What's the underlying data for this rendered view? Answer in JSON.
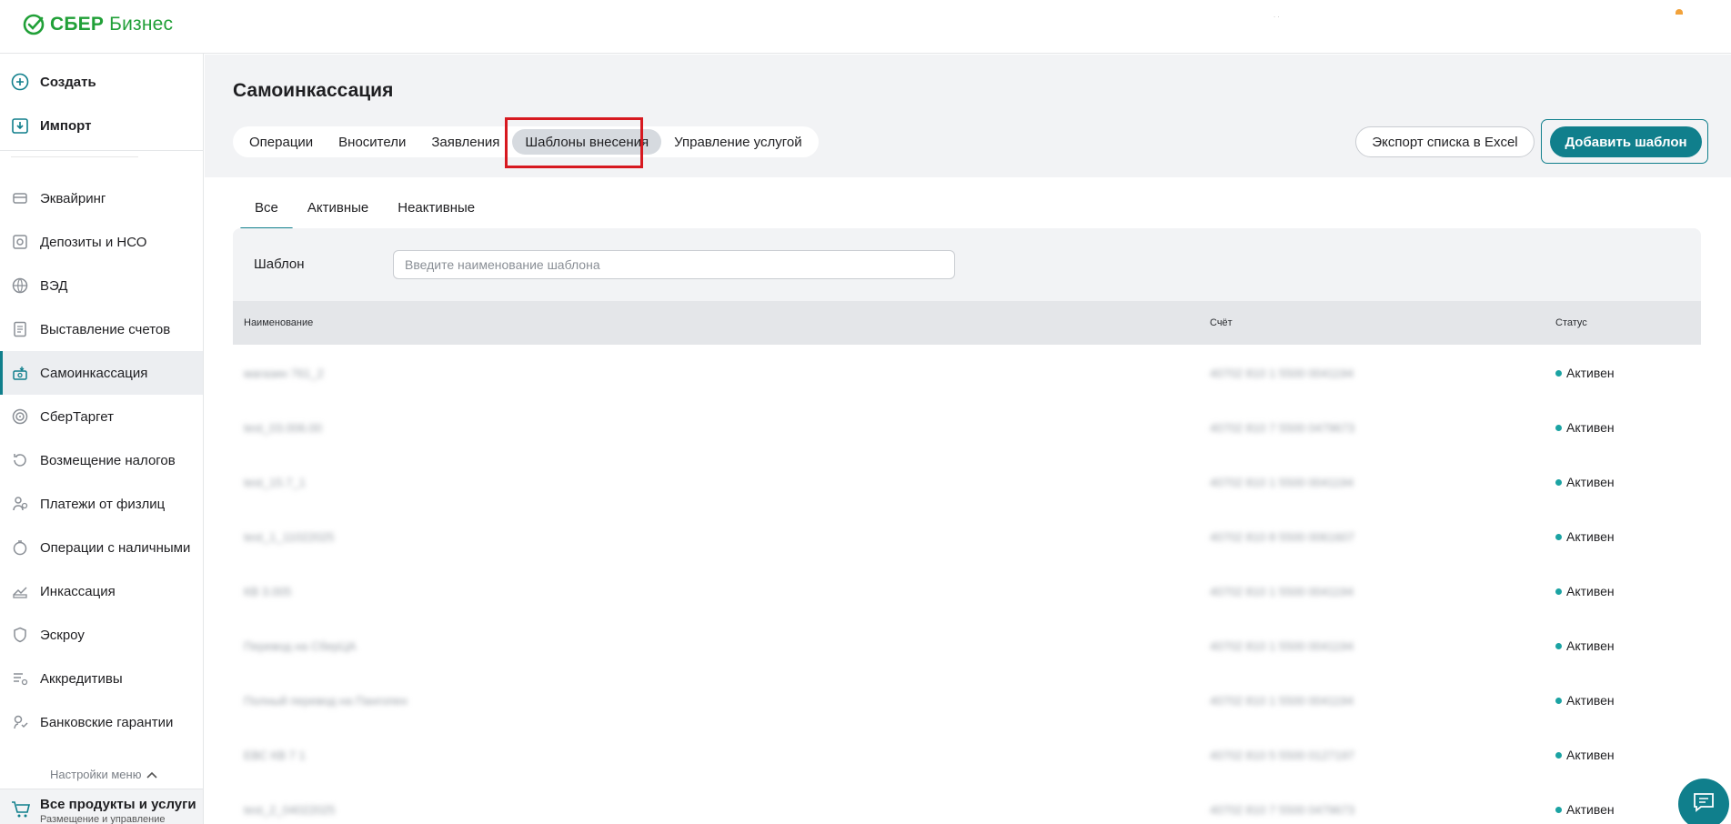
{
  "header": {
    "logo_bold": "СБЕР",
    "logo_rest": "Бизнес",
    "brand_color": "#21a038",
    "top_dots": ". ."
  },
  "sidebar": {
    "create_label": "Создать",
    "import_label": "Импорт",
    "items": [
      {
        "label": "Эквайринг",
        "icon": "acquiring-icon"
      },
      {
        "label": "Депозиты и НСО",
        "icon": "safe-icon"
      },
      {
        "label": "ВЭД",
        "icon": "globe-icon"
      },
      {
        "label": "Выставление счетов",
        "icon": "invoice-icon"
      },
      {
        "label": "Самоинкассация",
        "icon": "cash-box-icon",
        "active": true
      },
      {
        "label": "СберТаргет",
        "icon": "target-icon"
      },
      {
        "label": "Возмещение налогов",
        "icon": "tax-refund-icon"
      },
      {
        "label": "Платежи от физлиц",
        "icon": "person-payment-icon"
      },
      {
        "label": "Операции с наличными",
        "icon": "cash-operations-icon"
      },
      {
        "label": "Инкассация",
        "icon": "collection-icon"
      },
      {
        "label": "Эскроу",
        "icon": "shield-icon"
      },
      {
        "label": "Аккредитивы",
        "icon": "letter-of-credit-icon"
      },
      {
        "label": "Банковские гарантии",
        "icon": "guarantee-icon"
      }
    ],
    "settings_label": "Настройки меню",
    "bottom_label": "Все продукты и услуги",
    "bottom_sub": "Размещение и управление"
  },
  "page": {
    "title": "Самоинкассация",
    "tabs": [
      "Операции",
      "Вносители",
      "Заявления",
      "Шаблоны внесения",
      "Управление услугой"
    ],
    "active_tab": "Шаблоны внесения",
    "export_label": "Экспорт списка в Excel",
    "add_label": "Добавить шаблон",
    "accent_color": "#107f8c",
    "subtabs": [
      "Все",
      "Активные",
      "Неактивные"
    ],
    "active_subtab": "Все",
    "filter": {
      "label": "Шаблон",
      "placeholder": "Введите наименование шаблона",
      "value": ""
    }
  },
  "table": {
    "columns": [
      "Наименование",
      "Счёт",
      "Статус"
    ],
    "rows": [
      {
        "name": "магазин 761_2",
        "account": "40702 810 1 5500 0041194",
        "status": "Активен"
      },
      {
        "name": "test_03.006.00",
        "account": "40702 810 7 5500 0479673",
        "status": "Активен"
      },
      {
        "name": "test_15.7_1",
        "account": "40702 810 1 5500 0041194",
        "status": "Активен"
      },
      {
        "name": "test_1_11022025",
        "account": "40702 810 8 5500 0061607",
        "status": "Активен"
      },
      {
        "name": "КВ 3.005",
        "account": "40702 810 1 5500 0041194",
        "status": "Активен"
      },
      {
        "name": "Перевод на СберЦА",
        "account": "40702 810 1 5500 0041194",
        "status": "Активен"
      },
      {
        "name": "Полный перевод на Пангопен",
        "account": "40702 810 1 5500 0041194",
        "status": "Активен"
      },
      {
        "name": "ЕВС КВ 7 1",
        "account": "40702 810 5 5500 0127197",
        "status": "Активен"
      },
      {
        "name": "test_2_04022025",
        "account": "40702 810 7 5500 0479673",
        "status": "Активен"
      }
    ],
    "status_color": "#1ba3a3"
  }
}
